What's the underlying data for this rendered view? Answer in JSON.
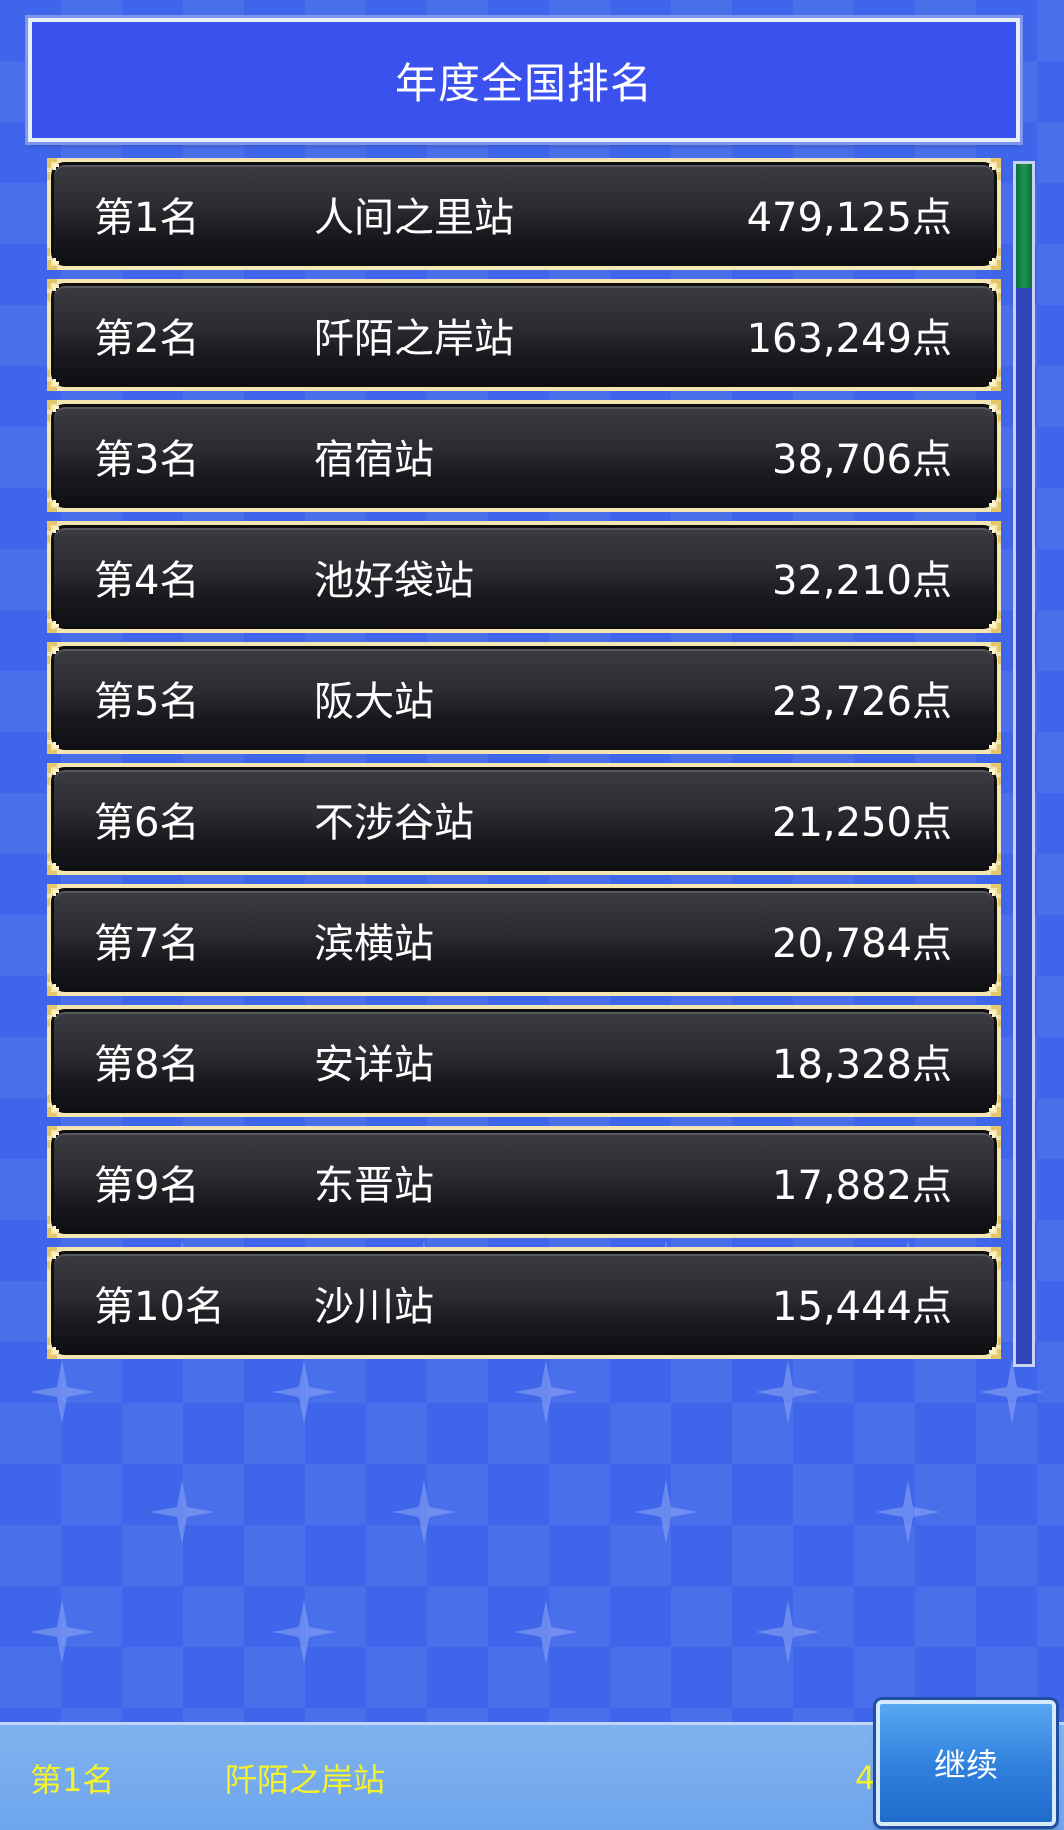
{
  "header": {
    "title": "年度全国排名"
  },
  "rankings": [
    {
      "rank": "第1名",
      "station": "人间之里站",
      "score": "479,125点"
    },
    {
      "rank": "第2名",
      "station": "阡陌之岸站",
      "score": "163,249点"
    },
    {
      "rank": "第3名",
      "station": "宿宿站",
      "score": "38,706点"
    },
    {
      "rank": "第4名",
      "station": "池好袋站",
      "score": "32,210点"
    },
    {
      "rank": "第5名",
      "station": "阪大站",
      "score": "23,726点"
    },
    {
      "rank": "第6名",
      "station": "不涉谷站",
      "score": "21,250点"
    },
    {
      "rank": "第7名",
      "station": "滨横站",
      "score": "20,784点"
    },
    {
      "rank": "第8名",
      "station": "安详站",
      "score": "18,328点"
    },
    {
      "rank": "第9名",
      "station": "东晋站",
      "score": "17,882点"
    },
    {
      "rank": "第10名",
      "station": "沙川站",
      "score": "15,444点"
    }
  ],
  "footer": {
    "rank": "第1名",
    "station": "阡陌之岸站",
    "score_partial": "4",
    "continue_label": "继续"
  },
  "colors": {
    "background": "#3f66ea",
    "title_bar": "#3a51ee",
    "row_frame": "#f3e6b3",
    "footer_text": "#f6f22a",
    "scroll_thumb": "#1c9450"
  }
}
